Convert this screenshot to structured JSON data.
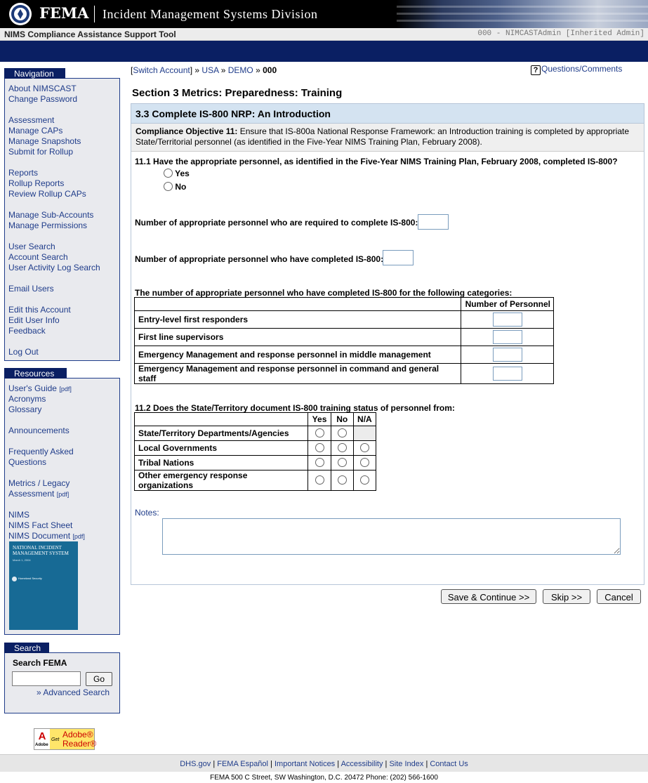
{
  "header": {
    "brand": "FEMA",
    "division": "Incident Management Systems Division"
  },
  "titlebar": {
    "app_name": "NIMS Compliance Assistance Support Tool",
    "user": "000 - NIMCASTAdmin [Inherited Admin]"
  },
  "navigation": {
    "title": "Navigation",
    "items": [
      "About NIMSCAST",
      "Change Password",
      "Assessment",
      "Manage CAPs",
      "Manage Snapshots",
      "Submit for Rollup",
      "Reports",
      "Rollup Reports",
      "Review Rollup CAPs",
      "Manage Sub-Accounts",
      "Manage Permissions",
      "User Search",
      "Account Search",
      "User Activity Log Search",
      "Email Users",
      "Edit this Account",
      "Edit User Info",
      "Feedback",
      "Log Out"
    ]
  },
  "resources": {
    "title": "Resources",
    "items": [
      "User's Guide",
      "Acronyms",
      "Glossary",
      "Announcements",
      "Frequently Asked",
      "Questions",
      "Metrics / Legacy",
      "Assessment",
      "NIMS",
      "NIMS Fact Sheet",
      "NIMS Document"
    ],
    "pdf_tag": "[pdf]",
    "cover": {
      "title": "NATIONAL INCIDENT MANAGEMENT SYSTEM",
      "date": "March 1, 2004",
      "logo": "Homeland Security"
    }
  },
  "search": {
    "title": "Search",
    "label": "Search FEMA",
    "go_label": "Go",
    "advanced": "» Advanced Search"
  },
  "adobe": {
    "logo": "Adobe",
    "get": "Get",
    "reader1": "Adobe®",
    "reader2": "Reader®"
  },
  "breadcrumb": {
    "switch": "Switch Account",
    "usa": "USA",
    "demo": "DEMO",
    "current": "000"
  },
  "questions_link": "Questions/Comments",
  "page_title": "Section 3 Metrics: Preparedness: Training",
  "section": {
    "header": "3.3 Complete IS-800 NRP: An Introduction",
    "objective_label": "Compliance Objective 11:",
    "objective_text": " Ensure that IS-800a National Response Framework: an Introduction training is completed by appropriate State/Territorial personnel (as identified in the Five-Year NIMS Training Plan, February 2008).",
    "q111": "11.1 Have the appropriate personnel, as identified in the Five-Year NIMS Training Plan, February 2008, completed IS-800?",
    "yes": "Yes",
    "no": "No",
    "required_label": "Number of appropriate personnel who are required to complete IS-800:",
    "completed_label": "Number of appropriate personnel who have completed IS-800:",
    "categories_label": "The number of appropriate personnel who have completed IS-800 for the following categories:",
    "categories_header": "Number of Personnel",
    "categories": [
      "Entry-level first responders",
      "First line supervisors",
      "Emergency Management and response personnel in middle management",
      "Emergency Management and response personnel in command and general staff"
    ],
    "q112": "11.2 Does the State/Territory document IS-800 training status of personnel from:",
    "q112_cols": [
      "Yes",
      "No",
      "N/A"
    ],
    "q112_rows": [
      "State/Territory Departments/Agencies",
      "Local Governments",
      "Tribal Nations",
      "Other emergency response organizations"
    ],
    "notes_label": "Notes:"
  },
  "buttons": {
    "save": "Save & Continue >>",
    "skip": "Skip >>",
    "cancel": "Cancel"
  },
  "footer": {
    "links": [
      "DHS.gov",
      "FEMA Español",
      "Important Notices",
      "Accessibility",
      "Site Index",
      "Contact Us"
    ],
    "address": "FEMA 500 C Street, SW Washington, D.C. 20472 Phone: (202) 566-1600"
  },
  "colors": {
    "navy": "#0a1f63",
    "link": "#1f3c8a",
    "section_header": "#d4e3f1"
  }
}
